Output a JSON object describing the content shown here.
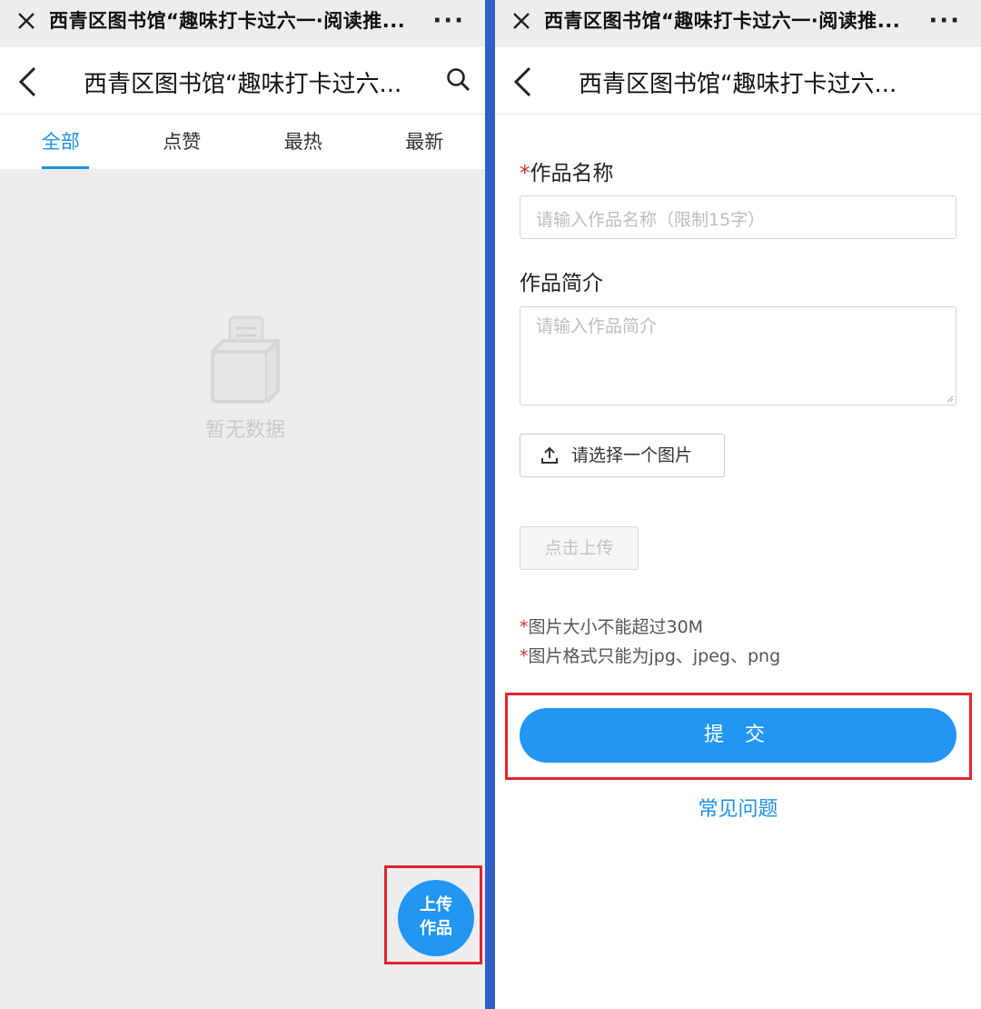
{
  "left": {
    "topbar": {
      "title": "西青区图书馆“趣味打卡过六一·阅读推..."
    },
    "header": {
      "title": "西青区图书馆“趣味打卡过六..."
    },
    "tabs": [
      {
        "label": "全部",
        "active": true
      },
      {
        "label": "点赞",
        "active": false
      },
      {
        "label": "最热",
        "active": false
      },
      {
        "label": "最新",
        "active": false
      }
    ],
    "empty_state": {
      "text": "暂无数据"
    },
    "upload_button": {
      "line1": "上传",
      "line2": "作品"
    }
  },
  "right": {
    "topbar": {
      "title": "西青区图书馆“趣味打卡过六一·阅读推..."
    },
    "header": {
      "title": "西青区图书馆“趣味打卡过六..."
    },
    "form": {
      "required_mark": "*",
      "name_label": "作品名称",
      "name_placeholder": "请输入作品名称（限制15字）",
      "intro_label": "作品简介",
      "intro_placeholder": "请输入作品简介",
      "pick_image_label": "请选择一个图片",
      "click_upload_label": "点击上传",
      "note1": "图片大小不能超过30M",
      "note2": "图片格式只能为jpg、jpeg、png",
      "submit_label": "提 交",
      "faq_label": "常见问题"
    }
  },
  "colors": {
    "accent": "#2196f3",
    "highlight": "#e0262e",
    "divider": "#2f5fc7"
  }
}
